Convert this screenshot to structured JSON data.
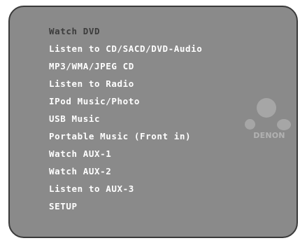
{
  "menu": {
    "selected_index": 0,
    "items": [
      {
        "label": "Watch DVD"
      },
      {
        "label": "Listen to CD/SACD/DVD-Audio"
      },
      {
        "label": "MP3/WMA/JPEG CD"
      },
      {
        "label": "Listen to Radio"
      },
      {
        "label": "IPod Music/Photo"
      },
      {
        "label": "USB Music"
      },
      {
        "label": "Portable Music (Front in)"
      },
      {
        "label": "Watch AUX-1"
      },
      {
        "label": "Watch AUX-2"
      },
      {
        "label": "Listen to AUX-3"
      },
      {
        "label": "SETUP"
      }
    ]
  },
  "brand": {
    "name": "DENON"
  },
  "colors": {
    "screen_background": "#8a8a8a",
    "screen_border": "#3a3a3a",
    "menu_text": "#ffffff",
    "selected_text": "#3c3c3c",
    "logo": "#a6a6a6"
  }
}
